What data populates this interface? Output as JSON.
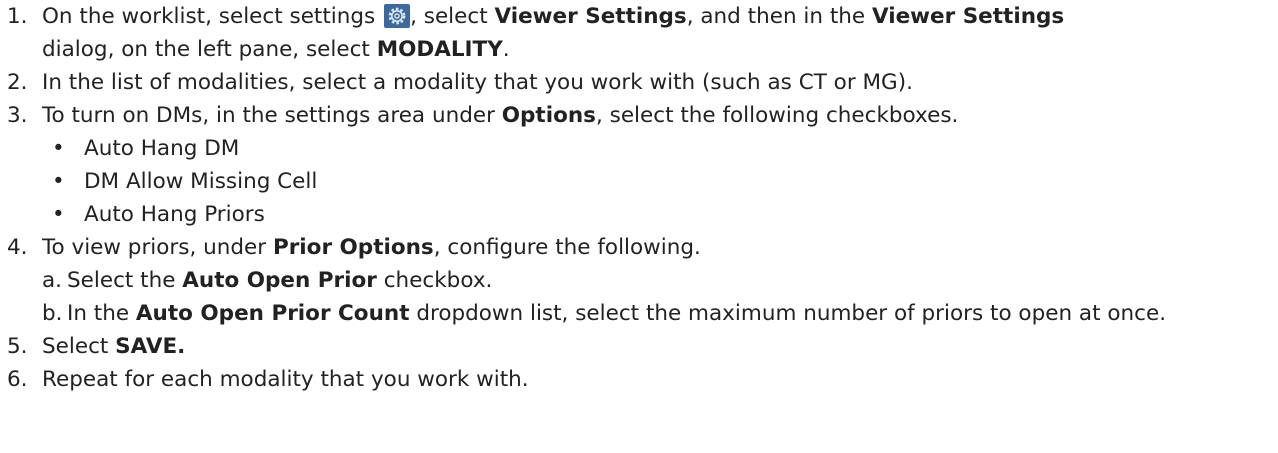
{
  "steps": [
    {
      "num": "1.",
      "parts": {
        "a": "On the worklist, select settings ",
        "b": ", select ",
        "c": "Viewer Settings",
        "d": ", and then in the ",
        "e": "Viewer Settings",
        "f": " dialog, on the left pane, select ",
        "g": "MODALITY",
        "h": "."
      },
      "icon": "settings-gear-icon"
    },
    {
      "num": "2.",
      "text": "In the list of modalities, select a modality that you work with (such as CT or MG)."
    },
    {
      "num": "3.",
      "parts": {
        "a": "To turn on DMs, in the settings area under ",
        "b": "Options",
        "c": ", select the following checkboxes."
      },
      "bullets": [
        "Auto Hang DM",
        "DM Allow Missing Cell",
        "Auto Hang Priors"
      ]
    },
    {
      "num": "4.",
      "parts": {
        "a": "To view priors, under ",
        "b": "Prior Options",
        "c": ", configure the following."
      },
      "subs": [
        {
          "letter": "a.",
          "a": "Select the ",
          "b": "Auto Open Prior",
          "c": " checkbox."
        },
        {
          "letter": "b.",
          "a": "In the ",
          "b": "Auto Open Prior Count",
          "c": " dropdown list, select the maximum number of priors to open at once."
        }
      ]
    },
    {
      "num": "5.",
      "parts": {
        "a": "Select ",
        "b": "SAVE."
      }
    },
    {
      "num": "6.",
      "text": "Repeat for each modality that you work with."
    }
  ],
  "colors": {
    "icon_bg": "#3d6a9e",
    "icon_fg": "#dbe6f3"
  }
}
